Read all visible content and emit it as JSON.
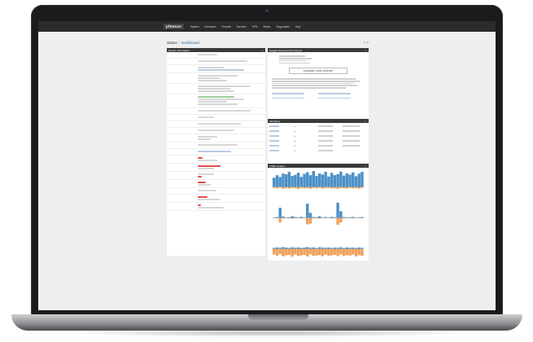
{
  "colors": {
    "in": "#4a90c8",
    "out": "#f2a05a",
    "nav": "#2b2b2b",
    "panel_header": "#3a3a3a"
  },
  "nav": {
    "logo": "pfSense",
    "menu": [
      "System",
      "Interfaces",
      "Firewall",
      "Services",
      "VPN",
      "Status",
      "Diagnostics",
      "Help"
    ]
  },
  "breadcrumb": {
    "root": "Status",
    "current": "Dashboard"
  },
  "left_panel": {
    "title": "System Information"
  },
  "right_panel": {
    "title": "Netgate Services And Support",
    "upgrade_label": "UPGRADE YOUR SUPPORT"
  },
  "interfaces_panel": {
    "title": "Interfaces"
  },
  "traffic_panel": {
    "title": "Traffic Graphs"
  },
  "traffic_graphs": [
    {
      "name": "wan",
      "in": [
        0.55,
        0.7,
        0.6,
        0.8,
        0.75,
        0.9,
        0.65,
        0.72,
        0.85,
        0.6,
        0.78,
        0.88,
        0.7,
        0.95,
        0.66,
        0.8,
        0.74,
        0.9,
        0.62,
        0.84,
        0.7,
        0.76,
        0.92,
        0.68,
        0.81,
        0.73,
        0.87,
        0.64,
        0.79,
        0.9
      ],
      "out": [
        0.1,
        0.15,
        0.08,
        0.2,
        0.12,
        0.18,
        0.1,
        0.14,
        0.22,
        0.09,
        0.16,
        0.12,
        0.2,
        0.1,
        0.15,
        0.08,
        0.18,
        0.12,
        0.1,
        0.16,
        0.14,
        0.2,
        0.11,
        0.13,
        0.17,
        0.1,
        0.15,
        0.12,
        0.19,
        0.1
      ]
    },
    {
      "name": "lan",
      "in": [
        0.02,
        0.05,
        0.6,
        0.08,
        0.03,
        0.04,
        0.1,
        0.05,
        0.03,
        0.06,
        0.02,
        0.85,
        0.3,
        0.05,
        0.04,
        0.1,
        0.03,
        0.05,
        0.02,
        0.06,
        0.04,
        0.9,
        0.4,
        0.05,
        0.03,
        0.04,
        0.06,
        0.02,
        0.03,
        0.05
      ],
      "out": [
        0.03,
        0.04,
        0.5,
        0.06,
        0.02,
        0.05,
        0.08,
        0.04,
        0.03,
        0.05,
        0.02,
        0.7,
        0.6,
        0.04,
        0.03,
        0.07,
        0.02,
        0.04,
        0.03,
        0.05,
        0.03,
        0.75,
        0.5,
        0.04,
        0.02,
        0.03,
        0.05,
        0.02,
        0.03,
        0.04
      ]
    },
    {
      "name": "opt1",
      "in": [
        0.05,
        0.08,
        0.06,
        0.1,
        0.07,
        0.05,
        0.09,
        0.06,
        0.08,
        0.05,
        0.07,
        0.1,
        0.06,
        0.08,
        0.05,
        0.09,
        0.07,
        0.06,
        0.08,
        0.05,
        0.07,
        0.06,
        0.09,
        0.05,
        0.08,
        0.06,
        0.07,
        0.05,
        0.08,
        0.06
      ],
      "out": [
        0.6,
        0.75,
        0.55,
        0.8,
        0.7,
        0.65,
        0.85,
        0.6,
        0.78,
        0.7,
        0.66,
        0.82,
        0.58,
        0.76,
        0.72,
        0.68,
        0.8,
        0.62,
        0.74,
        0.7,
        0.64,
        0.79,
        0.6,
        0.77,
        0.69,
        0.73,
        0.61,
        0.81,
        0.67,
        0.75
      ]
    }
  ]
}
